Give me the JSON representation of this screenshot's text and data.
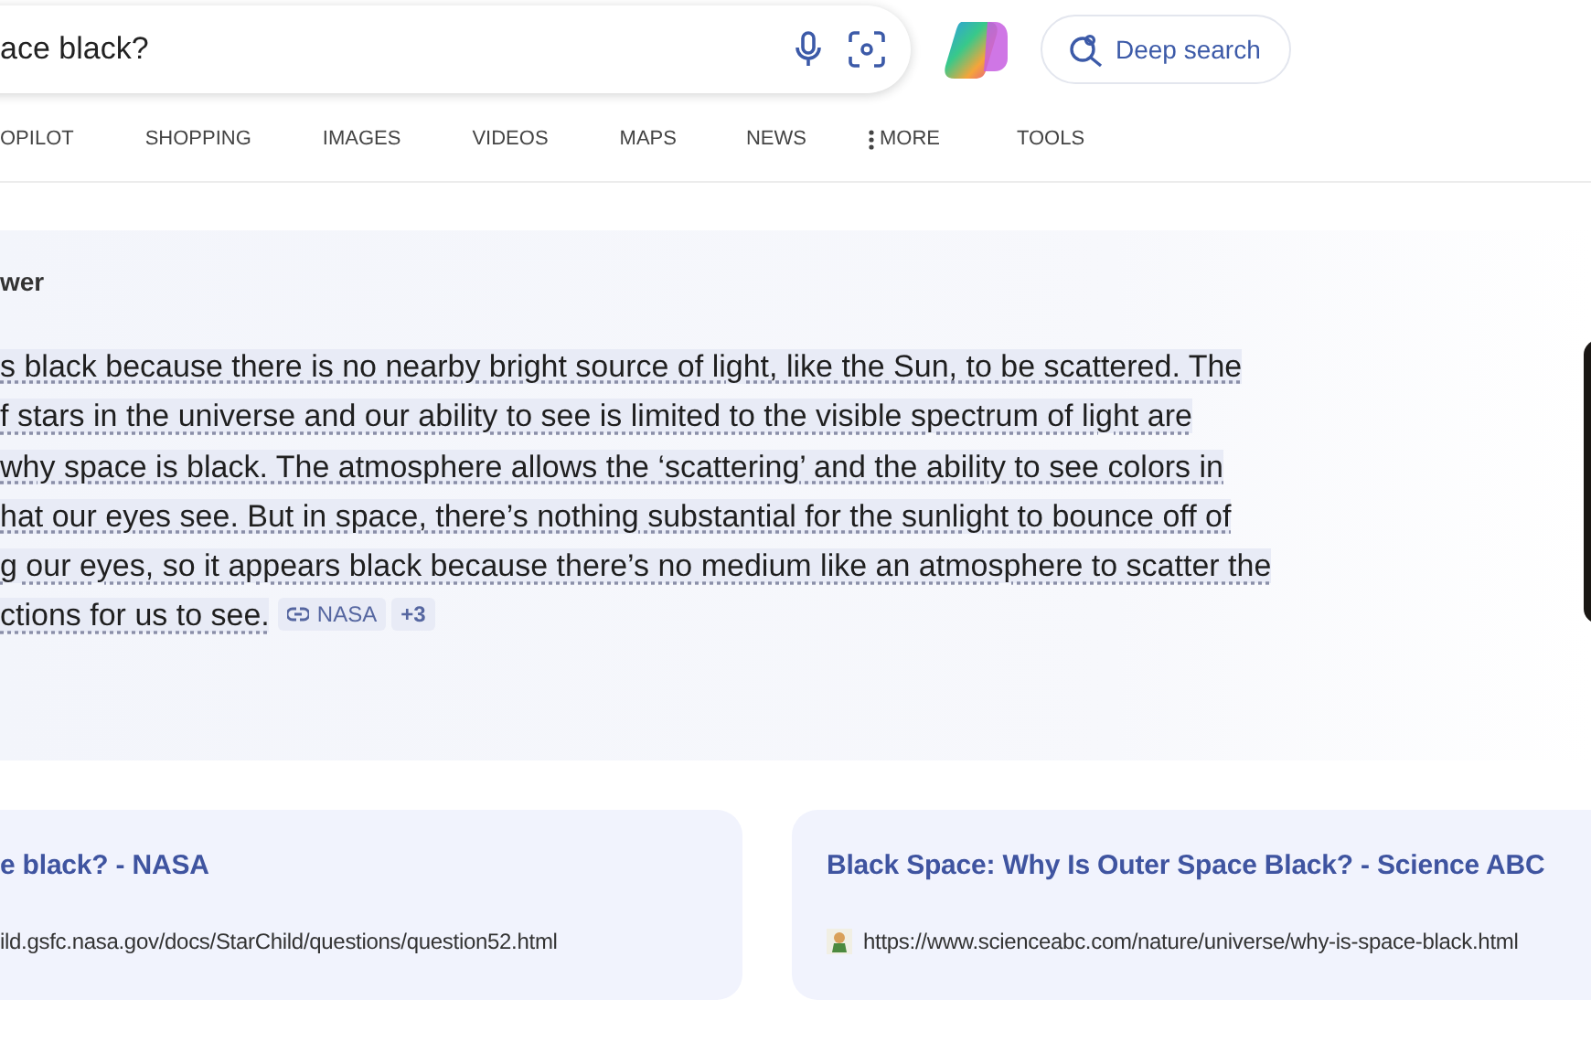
{
  "search": {
    "value": "ace black?"
  },
  "deep_search": {
    "label": "Deep search"
  },
  "tabs": [
    {
      "label": "OPILOT",
      "kind": "plain"
    },
    {
      "label": "SHOPPING",
      "kind": "plain"
    },
    {
      "label": "IMAGES",
      "kind": "plain"
    },
    {
      "label": "VIDEOS",
      "kind": "plain"
    },
    {
      "label": "MAPS",
      "kind": "plain"
    },
    {
      "label": "NEWS",
      "kind": "plain"
    },
    {
      "label": "MORE",
      "kind": "menu"
    },
    {
      "label": "TOOLS",
      "kind": "plain"
    }
  ],
  "answer": {
    "heading": "wer",
    "lines": [
      "s black because there is no nearby bright source of light, like the Sun, to be scattered. The",
      "f stars in the universe and our ability to see is limited to the visible spectrum of light are",
      "why space is black. The atmosphere allows the ‘scattering’ and the ability to see colors in",
      "hat our eyes see. But in space, there’s nothing substantial for the sunlight to bounce off of",
      "g our eyes, so it appears black because there’s no medium like an atmosphere to scatter the",
      "ctions for us to see."
    ],
    "source": "NASA",
    "more_sources": "+3"
  },
  "results": [
    {
      "title": "e black? - NASA",
      "url": "ild.gsfc.nasa.gov/docs/StarChild/questions/question52.html",
      "favicon": false
    },
    {
      "title": "Black Space: Why Is Outer Space Black? - Science ABC",
      "url": "https://www.scienceabc.com/nature/universe/why-is-space-black.html",
      "favicon": true
    }
  ]
}
